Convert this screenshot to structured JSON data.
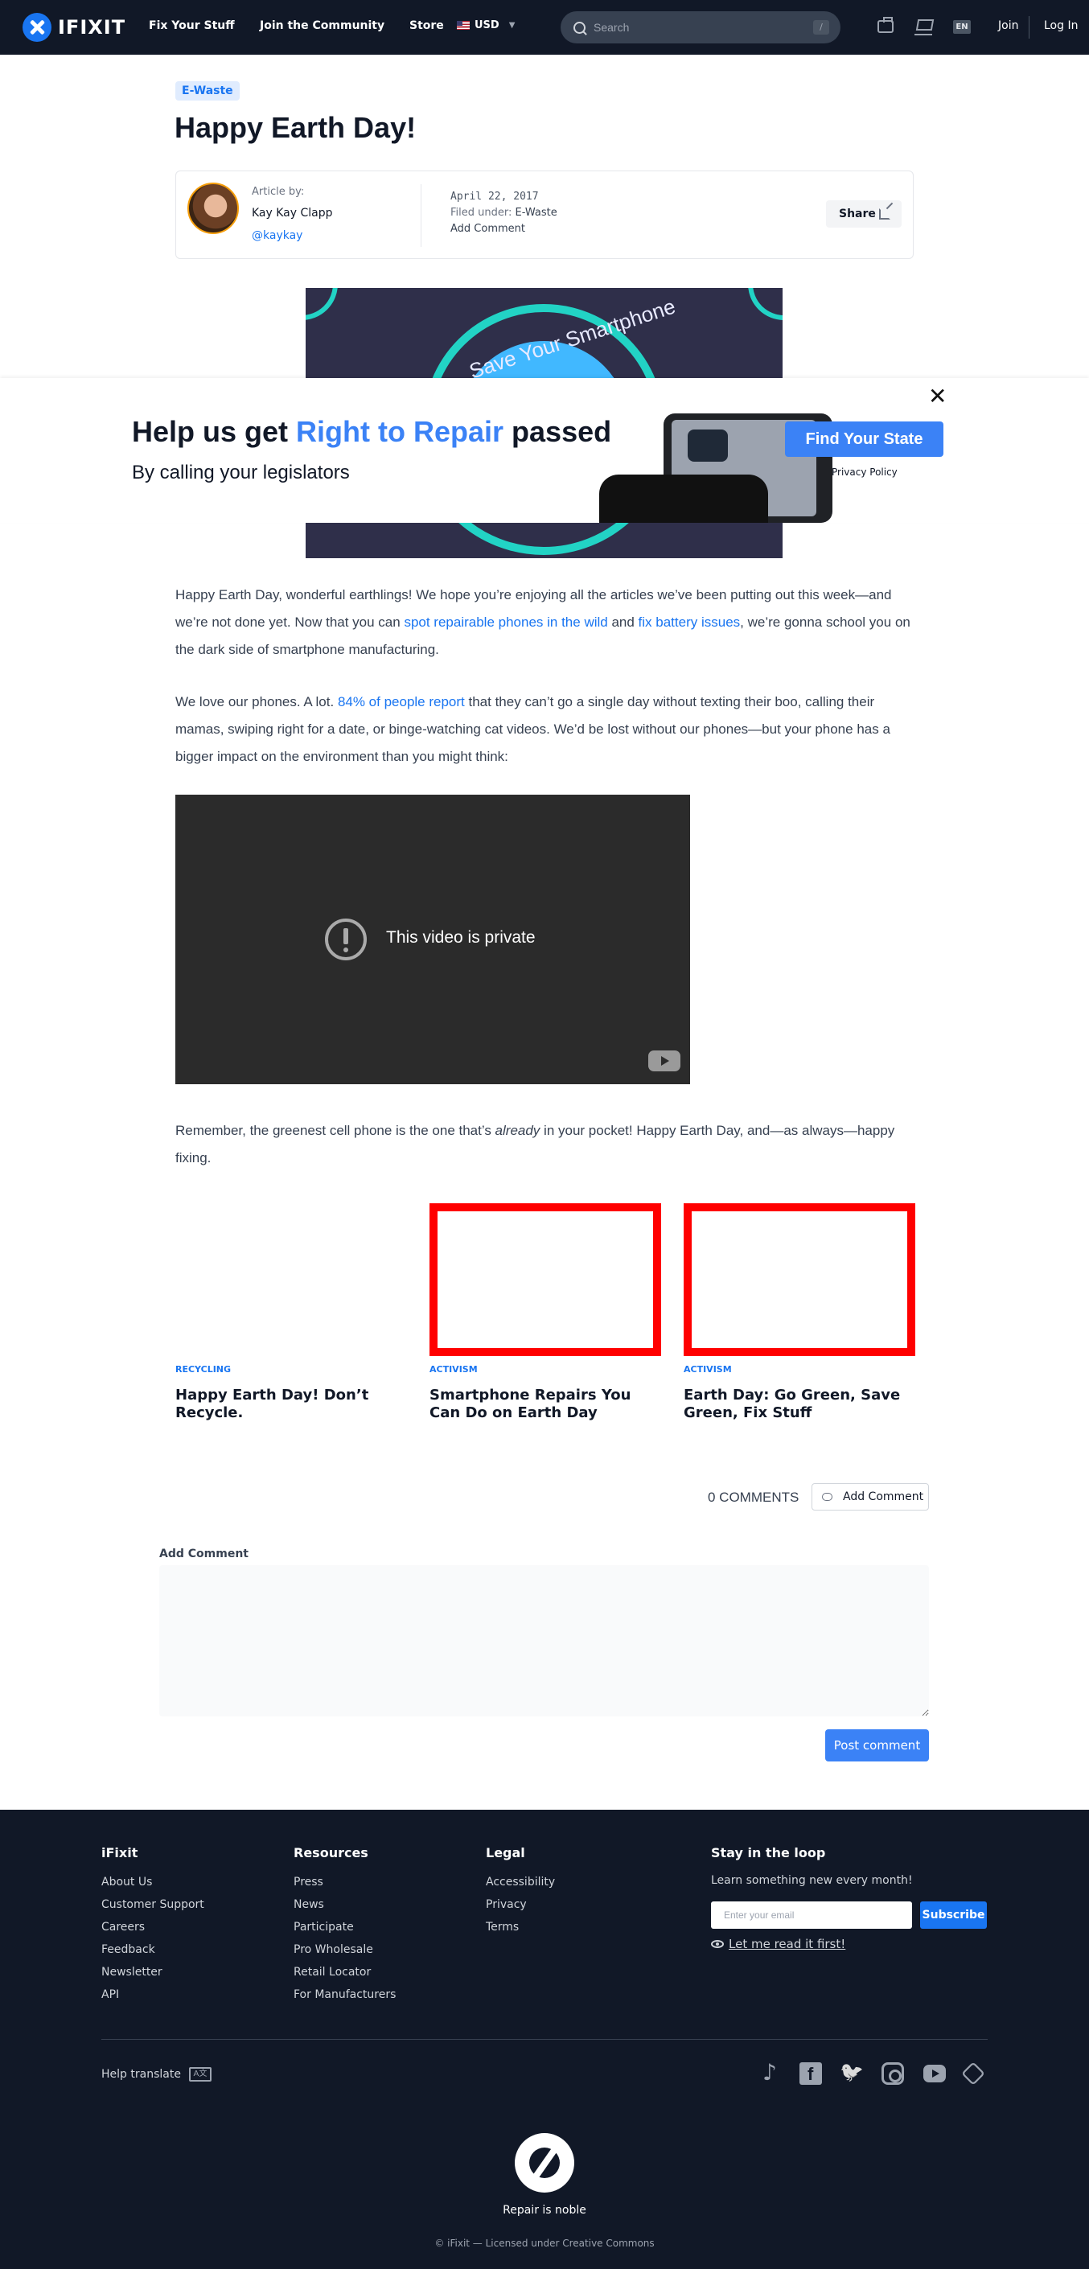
{
  "header": {
    "brand": "IFIXIT",
    "nav": [
      "Fix Your Stuff",
      "Join the Community",
      "Store"
    ],
    "currency": "USD",
    "search_placeholder": "Search",
    "search_shortcut": "/",
    "language": "EN",
    "join": "Join",
    "login": "Log In"
  },
  "article": {
    "category": "E-Waste",
    "title": "Happy Earth Day!",
    "author_label": "Article by:",
    "author_name": "Kay Kay Clapp",
    "author_handle": "@kaykay",
    "date": "April 22, 2017",
    "filed_under_label": "Filed under:",
    "filed_under": "E-Waste",
    "add_comment": "Add Comment",
    "share": "Share",
    "hero_text": "Save Your Smartphone"
  },
  "banner": {
    "headline_pre": "Help us get ",
    "headline_highlight": "Right to Repair",
    "headline_post": " passed",
    "subline": "By calling your legislators",
    "cta": "Find Your State",
    "privacy": "Privacy Policy",
    "close": "✕"
  },
  "body": {
    "p1_a": "Happy Earth Day, wonderful earthlings! We hope you’re enjoying all the articles we’ve been putting out this week—and we’re not done yet. Now that you can ",
    "p1_link1": "spot repairable phones in the wild",
    "p1_b": " and ",
    "p1_link2": "fix battery issues",
    "p1_c": ", we’re gonna school you on the dark side of smartphone manufacturing.",
    "p2_a": "We love our phones. A lot. ",
    "p2_link": "84% of people report",
    "p2_b": " that they can’t go a single day without texting their boo, calling their mamas, swiping right for a date, or binge-watching cat videos. We’d be lost without our phones—but your phone has a bigger impact on the environment than you might think:",
    "video_status": "This video is private",
    "p3_a": "Remember, the greenest cell phone is the one that’s ",
    "p3_em": "already",
    "p3_b": " in your pocket! Happy Earth Day, and—as always—happy fixing."
  },
  "related": [
    {
      "category": "RECYCLING",
      "title": "Happy Earth Day! Don’t Recycle."
    },
    {
      "category": "ACTIVISM",
      "title": "Smartphone Repairs You Can Do on Earth Day"
    },
    {
      "category": "ACTIVISM",
      "title": "Earth Day: Go Green, Save Green, Fix Stuff"
    }
  ],
  "comments": {
    "count_label": "0 COMMENTS",
    "add_button": "Add Comment",
    "form_label": "Add Comment",
    "post_button": "Post comment"
  },
  "footer": {
    "columns": [
      {
        "heading": "iFixit",
        "links": [
          "About Us",
          "Customer Support",
          "Careers",
          "Feedback",
          "Newsletter",
          "API"
        ]
      },
      {
        "heading": "Resources",
        "links": [
          "Press",
          "News",
          "Participate",
          "Pro Wholesale",
          "Retail Locator",
          "For Manufacturers"
        ]
      },
      {
        "heading": "Legal",
        "links": [
          "Accessibility",
          "Privacy",
          "Terms"
        ]
      }
    ],
    "newsletter_heading": "Stay in the loop",
    "newsletter_sub": "Learn something new every month!",
    "email_placeholder": "Enter your email",
    "subscribe": "Subscribe",
    "read_first": "Let me read it first!",
    "help_translate": "Help translate",
    "translate_icon_text": "A文",
    "motto": "Repair is noble",
    "copyright": "© iFixit — Licensed under Creative Commons"
  },
  "colors": {
    "brand_blue": "#1975f1",
    "header_bg": "#111827",
    "banner_highlight": "#3b82f6",
    "placeholder_outline": "#ff0000"
  }
}
